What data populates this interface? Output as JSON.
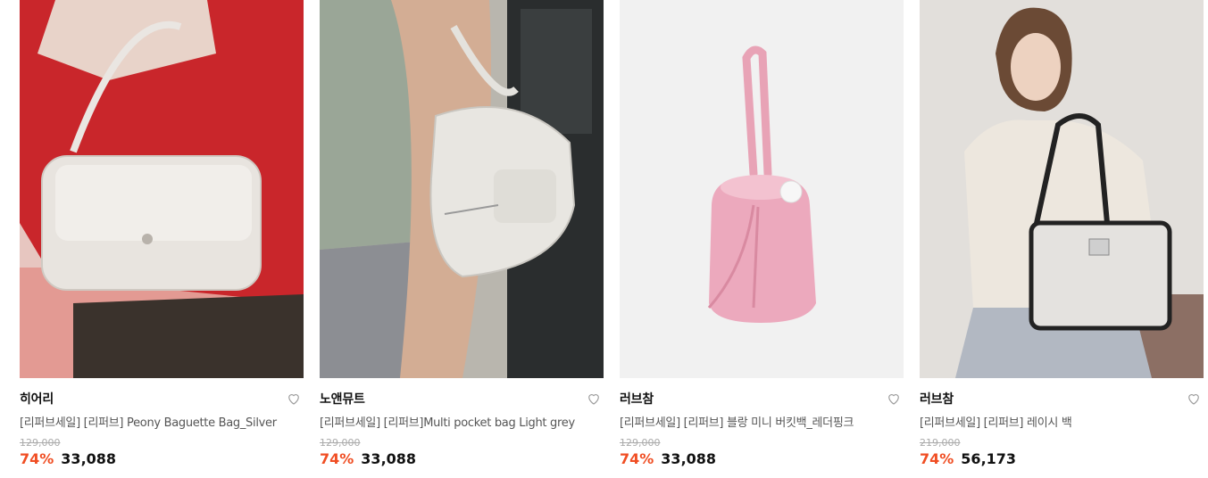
{
  "products": [
    {
      "brand": "히어리",
      "title": "[리퍼브세일] [리퍼브] Peony Baguette Bag_Silver",
      "original_price": "129,000",
      "discount_rate": "74%",
      "sale_price": "33,088",
      "wish_icon": "heart-outline-icon"
    },
    {
      "brand": "노앤뮤트",
      "title": "[리퍼브세일] [리퍼브]Multi pocket bag Light grey",
      "original_price": "129,000",
      "discount_rate": "74%",
      "sale_price": "33,088",
      "wish_icon": "heart-outline-icon"
    },
    {
      "brand": "러브참",
      "title": "[리퍼브세일] [리퍼브] 블랑 미니 버킷백_레더핑크",
      "original_price": "129,000",
      "discount_rate": "74%",
      "sale_price": "33,088",
      "wish_icon": "heart-outline-icon"
    },
    {
      "brand": "러브참",
      "title": "[리퍼브세일] [리퍼브] 레이시 백",
      "original_price": "219,000",
      "discount_rate": "74%",
      "sale_price": "56,173",
      "wish_icon": "heart-outline-icon"
    }
  ],
  "colors": {
    "discount": "#f04e23",
    "original_price": "#aaaaaa"
  }
}
